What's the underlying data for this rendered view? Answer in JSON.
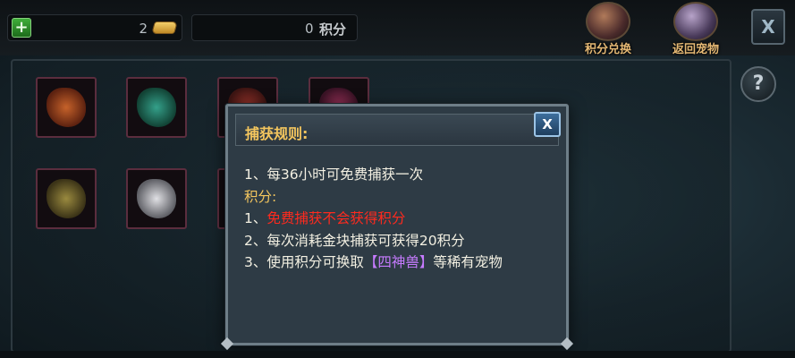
{
  "topbar": {
    "add_label": "+",
    "gold_count": "2",
    "points_count": "0",
    "points_label": "积分",
    "exchange_label": "积分兑换",
    "return_label": "返回宠物",
    "close_label": "X"
  },
  "help": {
    "label": "?"
  },
  "dialog": {
    "title": "捕获规则:",
    "close_label": "X",
    "line1": "1、每36小时可免费捕获一次",
    "points_heading": "积分:",
    "rule1_prefix": "1、",
    "rule1_text": "免费捕获不会获得积分",
    "rule2": "2、每次消耗金块捕获可获得20积分",
    "rule3_prefix": "3、使用积分可换取",
    "rule3_highlight": "【四神兽】",
    "rule3_suffix": "等稀有宠物"
  },
  "colors": {
    "title": "#f4c65e",
    "warning": "#ff2a1e",
    "highlight": "#c77bff",
    "body_text": "#f3f0e2"
  }
}
